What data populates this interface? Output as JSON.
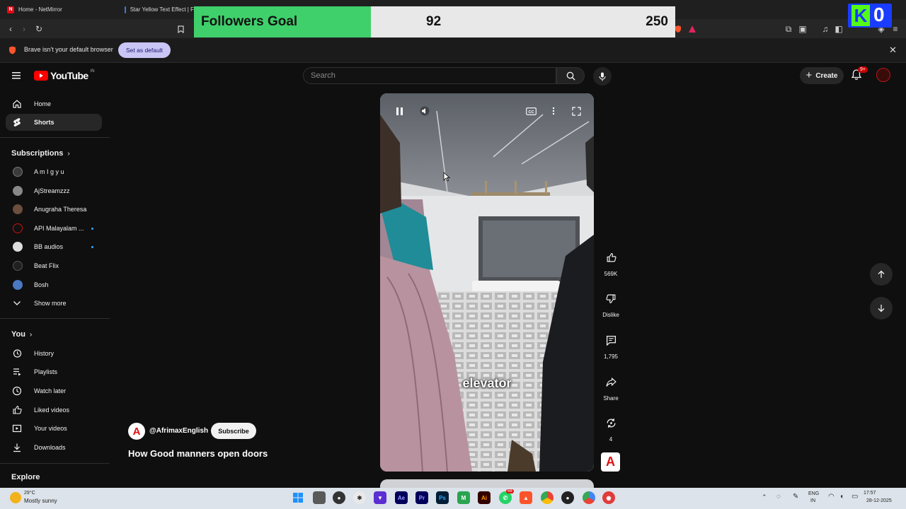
{
  "browser": {
    "tabs": [
      {
        "title": "Home - NetMirror"
      },
      {
        "title": "Star Yellow Text Effect | F"
      }
    ],
    "infobar": {
      "message": "Brave isn't your default browser",
      "button": "Set as default"
    }
  },
  "overlay": {
    "label": "Followers Goal",
    "current": "92",
    "goal": "250",
    "progress_fraction": 0.368,
    "kick_count": "0",
    "colors": {
      "fill": "#3fd06b",
      "track": "#e8e8e8",
      "kick_bg": "#1a3cff",
      "kick_green": "#53fc18"
    }
  },
  "youtube": {
    "logo": "YouTube",
    "region": "IN",
    "search_placeholder": "Search",
    "create_label": "Create",
    "notification_badge": "9+",
    "sidebar": {
      "main": [
        {
          "label": "Home",
          "icon": "home-icon"
        },
        {
          "label": "Shorts",
          "icon": "shorts-icon"
        }
      ],
      "subscriptions_header": "Subscriptions",
      "subscriptions": [
        {
          "label": "A m I g y u",
          "dot": false
        },
        {
          "label": "AjStreamzzz",
          "dot": false
        },
        {
          "label": "Anugraha Theresa",
          "dot": false
        },
        {
          "label": "API Malayalam ...",
          "dot": true
        },
        {
          "label": "BB audios",
          "dot": true
        },
        {
          "label": "Beat Flix",
          "dot": false
        },
        {
          "label": "Bosh",
          "dot": false
        }
      ],
      "show_more": "Show more",
      "you_header": "You",
      "you_items": [
        {
          "label": "History",
          "icon": "history-icon"
        },
        {
          "label": "Playlists",
          "icon": "playlists-icon"
        },
        {
          "label": "Watch later",
          "icon": "watch-later-icon"
        },
        {
          "label": "Liked videos",
          "icon": "like-icon"
        },
        {
          "label": "Your videos",
          "icon": "your-videos-icon"
        },
        {
          "label": "Downloads",
          "icon": "download-icon"
        }
      ],
      "explore_header": "Explore"
    },
    "short": {
      "caption": "elevator",
      "channel": "@AfrimaxEnglish",
      "subscribe": "Subscribe",
      "title": "How Good manners open doors",
      "likes": "569K",
      "dislike": "Dislike",
      "comments": "1,795",
      "share": "Share",
      "remix": "4"
    }
  },
  "taskbar": {
    "weather_temp": "29°C",
    "weather_desc": "Mostly sunny",
    "lang1": "ENG",
    "lang2": "IN",
    "time": "17:57",
    "date": "28-12-2025",
    "whatsapp_badge": "68"
  }
}
